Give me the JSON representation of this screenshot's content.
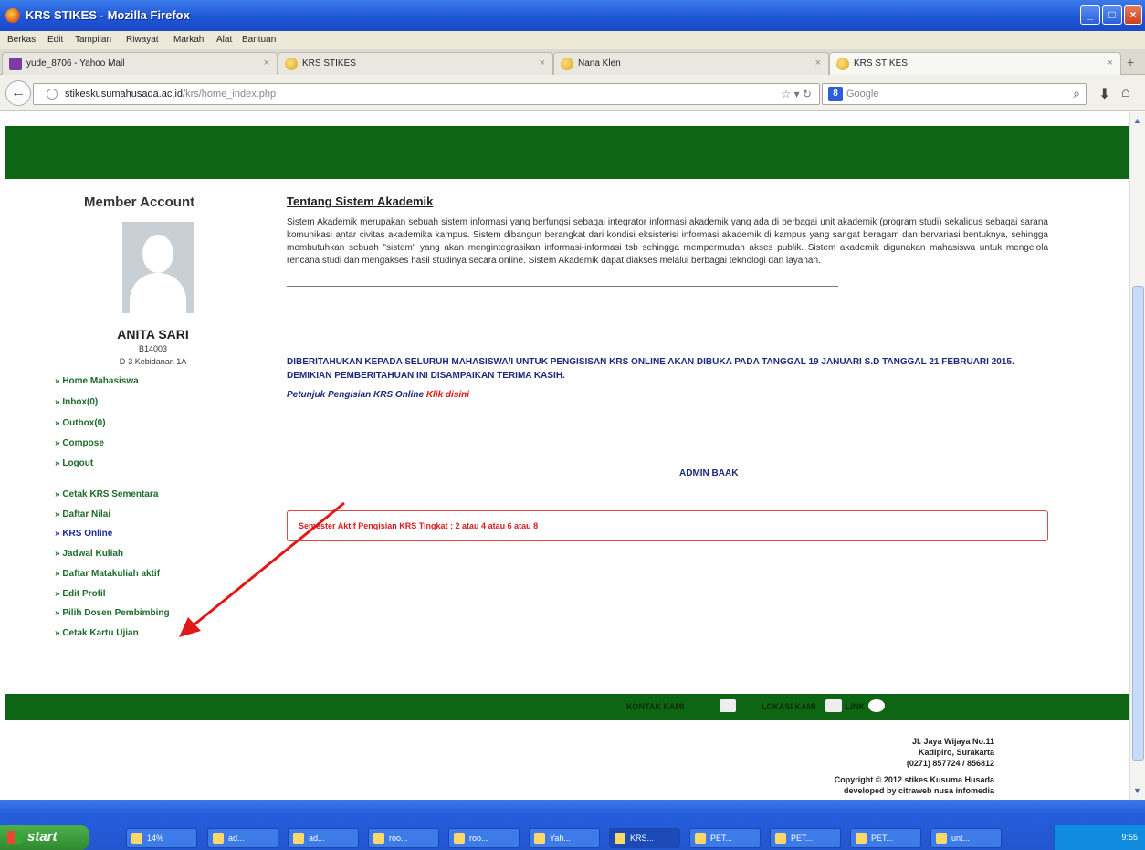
{
  "window": {
    "title": "KRS STIKES - Mozilla Firefox"
  },
  "menu": [
    "Berkas",
    "Edit",
    "Tampilan",
    "Riwayat",
    "Markah",
    "Alat",
    "Bantuan"
  ],
  "tabs": [
    {
      "label": "yude_8706 - Yahoo Mail"
    },
    {
      "label": "KRS STIKES"
    },
    {
      "label": "Nana Klen"
    },
    {
      "label": "KRS STIKES"
    }
  ],
  "nav": {
    "url_host": "stikeskusumahusada.ac.id",
    "url_path": "/krs/home_index.php",
    "search_placeholder": "Google",
    "search_engine_label": "8"
  },
  "sidebar": {
    "title": "Member Account",
    "user_name": "ANITA SARI",
    "user_nim": "B14003",
    "user_program": "D-3 Kebidanan 1A",
    "group1": [
      "» Home Mahasiswa",
      "» Inbox(0)",
      "» Outbox(0)",
      "» Compose",
      "» Logout"
    ],
    "group2": [
      "» Cetak KRS Sementara",
      "» Daftar Nilai",
      "» KRS Online",
      "» Jadwal Kuliah",
      "» Daftar Matakuliah aktif",
      "» Edit Profil",
      "» Pilih Dosen Pembimbing",
      "» Cetak Kartu Ujian"
    ]
  },
  "main": {
    "heading": "Tentang Sistem Akademik",
    "description": "Sistem Akademik merupakan sebuah sistem informasi yang berfungsi sebagai integrator informasi akademik yang ada di berbagai unit akademik (program studi) sekaligus sebagai sarana komunikasi antar civitas akademika kampus. Sistem dibangun berangkat dari kondisi eksisterisi informasi akademik di kampus yang sangat beragam dan bervariasi bentuknya, sehingga membutuhkan sebuah \"sistem\" yang akan mengintegrasikan informasi-informasi tsb sehingga mempermudah akses publik. Sistem akademik digunakan mahasiswa untuk mengelola rencana studi dan mengakses hasil studinya secara online. Sistem Akademik dapat diakses melalui berbagai teknologi dan layanan.",
    "announcement": "DIBERITAHUKAN KEPADA SELURUH MAHASISWA/I UNTUK PENGISISAN KRS ONLINE AKAN DIBUKA PADA TANGGAL 19 JANUARI S.D TANGGAL 21 FEBRUARI 2015. DEMIKIAN PEMBERITAHUAN INI DISAMPAIKAN TERIMA KASIH.",
    "petunjuk_label": "Petunjuk Pengisian KRS Online",
    "petunjuk_link": "Klik disini",
    "signature": "ADMIN BAAK",
    "semester_notice": "Semester Aktif Pengisian KRS Tingkat : 2 atau 4 atau 6 atau 8"
  },
  "footer": {
    "links": [
      "KONTAK KAMI",
      "LOKASI KAMI",
      "LINK"
    ],
    "address": [
      "Jl. Jaya Wijaya No.11",
      "Kadipiro, Surakarta",
      "(0271) 857724 / 856812"
    ],
    "copyright": [
      "Copyright © 2012 stikes Kusuma Husada",
      "developed by citraweb nusa infomedia"
    ]
  },
  "taskbar": {
    "start_label": "start",
    "items": [
      "14%",
      "ad...",
      "ad...",
      "roo...",
      "roo...",
      "Yah...",
      "KRS...",
      "PET...",
      "PET...",
      "PET...",
      "unt..."
    ],
    "clock": "9:55"
  }
}
